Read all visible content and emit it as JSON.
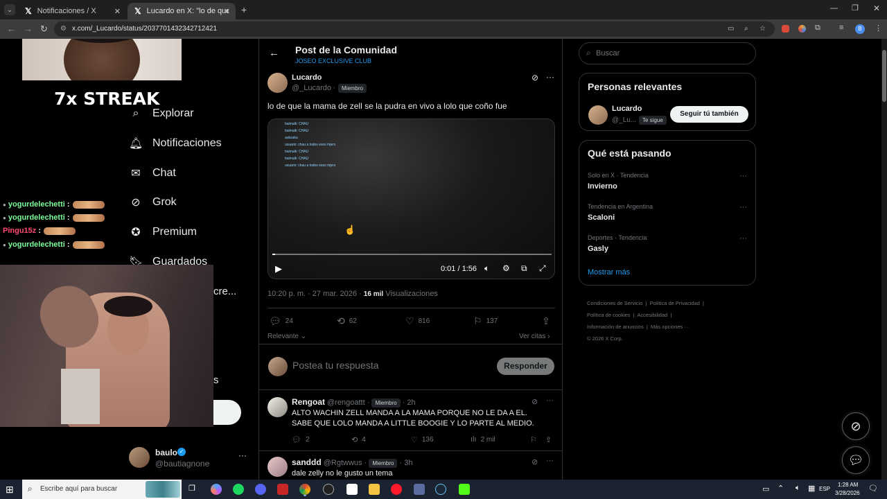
{
  "browser": {
    "tabs": [
      {
        "title": "Notificaciones / X"
      },
      {
        "title": "Lucardo en X: \"lo de que la mam"
      }
    ],
    "url": "x.com/_Lucardo/status/2037701432342712421"
  },
  "sidebar": {
    "items": [
      {
        "label": "Explorar",
        "icon": "search-icon"
      },
      {
        "label": "Notificaciones",
        "icon": "bell-icon"
      },
      {
        "label": "Chat",
        "icon": "mail-icon"
      },
      {
        "label": "Grok",
        "icon": "grok-icon"
      },
      {
        "label": "Premium",
        "icon": "verified-icon"
      },
      {
        "label": "Guardados",
        "icon": "bookmark-icon"
      }
    ],
    "partial_cre": "cre...",
    "partial_s": "s",
    "account": {
      "name": "baulo",
      "handle": "@bautiagnone"
    }
  },
  "overlay": {
    "streak": "7x STREAK",
    "chat": [
      {
        "user": "yogurdelechetti",
        "sep": ":"
      },
      {
        "user": "yogurdelechetti",
        "sep": ":"
      },
      {
        "user": "Pingu15z",
        "sep": ":"
      },
      {
        "user": "yogurdelechetti",
        "sep": ":"
      }
    ]
  },
  "header": {
    "title": "Post de la Comunidad",
    "community": "JOSEO EXCLUSIVE CLUB"
  },
  "post": {
    "author": "Lucardo",
    "handle": "@_Lucardo",
    "dot": "·",
    "badge": "Miembro",
    "text": "lo de que la mama de zell se la pudra en vivo a lolo que coño fue",
    "video": {
      "time": "0:01 / 1:56",
      "progress": 0.01,
      "chat": [
        "baimalk: CHAU",
        "baimalk: CHAU",
        "aukzaku",
        "usuario: chau a todos esos mjers",
        "baimalk: CHAU",
        "baimalk: CHAU",
        "usuario: chau a todos esos mjers"
      ]
    },
    "timestamp": "10:20 p. m. · 27 mar. 2026 · ",
    "views_count": "16 mil",
    "views_label": " Visualizaciones",
    "replies": "24",
    "reposts": "62",
    "likes": "816",
    "bookmarks": "137",
    "sort": "Relevante",
    "quotes": "Ver citas"
  },
  "composer": {
    "placeholder": "Postea tu respuesta",
    "button": "Responder"
  },
  "replies": [
    {
      "name": "Rengoat",
      "handle": "@rengoattt",
      "badge": "Miembro",
      "age": "2h",
      "text": "ALTO WACHIN ZELL MANDA A LA MAMA PORQUE NO LE DA A EL. SABE QUE LOLO MANDA A LITTLE BOOGIE Y LO PARTE AL MEDIO.",
      "replies": "2",
      "reposts": "4",
      "likes": "136",
      "views": "2 mil"
    },
    {
      "name": "sanddd",
      "handle": "@Rgtwwus",
      "badge": "Miembro",
      "age": "3h",
      "text": "dale zelly no le gusto un tema"
    }
  ],
  "search": {
    "placeholder": "Buscar"
  },
  "relevant": {
    "title": "Personas relevantes",
    "name": "Lucardo",
    "handle": "@_Lu...",
    "follows_you": "Te sigue",
    "button": "Seguir tú también"
  },
  "trends": {
    "title": "Qué está pasando",
    "items": [
      {
        "context": "Solo en X · Tendencia",
        "name": "Invierno"
      },
      {
        "context": "Tendencia en Argentina",
        "name": "Scaloni"
      },
      {
        "context": "Deportes · Tendencia",
        "name": "Gasly"
      }
    ],
    "more": "Mostrar más"
  },
  "footer": {
    "links": [
      "Condiciones de Servicio",
      "Política de Privacidad",
      "Política de cookies",
      "Accesibilidad",
      "Información de anuncios",
      "Más opciones ···"
    ],
    "copyright": "© 2026 X Corp."
  },
  "taskbar": {
    "search_placeholder": "Escribe aquí para buscar",
    "lang": "ESP",
    "time": "1:28 AM",
    "date": "3/28/2026"
  }
}
